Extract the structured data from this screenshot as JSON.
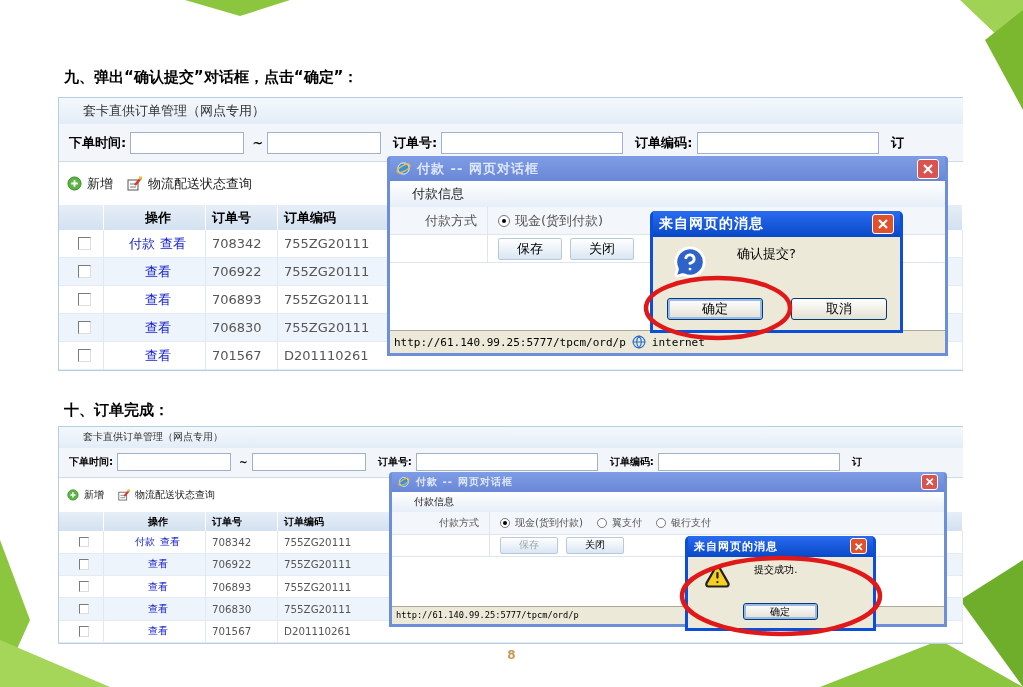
{
  "sections": [
    {
      "heading": "九、弹出“确认提交”对话框，点击“确定”：",
      "highlight": true,
      "app": {
        "title": "套卡直供订单管理（网点专用）",
        "filters": [
          {
            "label": "下单时间:"
          },
          {
            "label": "~"
          },
          {
            "label": "订单号:"
          },
          {
            "label": "订单编码:"
          },
          {
            "label": "订"
          }
        ],
        "toolbar": [
          {
            "kind": "add",
            "label": "新增"
          },
          {
            "kind": "query",
            "label": "物流配送状态查询"
          }
        ],
        "columns": [
          "操作",
          "订单号",
          "订单编码"
        ],
        "rows": [
          {
            "checked": false,
            "actions": [
              "付款",
              "查看"
            ],
            "order_no": "708342",
            "order_code": "755ZG20111"
          },
          {
            "checked": false,
            "actions": [
              "查看"
            ],
            "order_no": "706922",
            "order_code": "755ZG20111"
          },
          {
            "checked": false,
            "actions": [
              "查看"
            ],
            "order_no": "706893",
            "order_code": "755ZG20111"
          },
          {
            "checked": false,
            "actions": [
              "查看"
            ],
            "order_no": "706830",
            "order_code": "755ZG20111"
          },
          {
            "checked": false,
            "actions": [
              "查看"
            ],
            "order_no": "701567",
            "order_code": "D201110261"
          }
        ]
      },
      "dialog": {
        "title": "付款 -- 网页对话框",
        "section": "付款信息",
        "payment_label": "付款方式",
        "options": [
          {
            "label": "现金(货到付款)",
            "selected": true
          }
        ],
        "buttons": [
          {
            "label": "保存",
            "disabled": false
          },
          {
            "label": "关闭",
            "disabled": false
          }
        ],
        "status_url": "http://61.140.99.25:5777/tpcm/ord/p",
        "status_zone": "internet"
      },
      "message": {
        "title": "来自网页的消息",
        "kind": "question",
        "text": "确认提交?",
        "buttons": [
          {
            "label": "确定",
            "focused": true
          },
          {
            "label": "取消",
            "focused": false
          }
        ]
      }
    },
    {
      "heading": "十、订单完成：",
      "highlight": true,
      "app": {
        "title": "套卡直供订单管理（网点专用）",
        "filters": [
          {
            "label": "下单时间:"
          },
          {
            "label": "~"
          },
          {
            "label": "订单号:"
          },
          {
            "label": "订单编码:"
          },
          {
            "label": "订"
          }
        ],
        "toolbar": [
          {
            "kind": "add",
            "label": "新增"
          },
          {
            "kind": "query",
            "label": "物流配送状态查询"
          }
        ],
        "columns": [
          "操作",
          "订单号",
          "订单编码"
        ],
        "rows": [
          {
            "checked": false,
            "actions": [
              "付款",
              "查看"
            ],
            "order_no": "708342",
            "order_code": "755ZG20111"
          },
          {
            "checked": false,
            "actions": [
              "查看"
            ],
            "order_no": "706922",
            "order_code": "755ZG20111"
          },
          {
            "checked": false,
            "actions": [
              "查看"
            ],
            "order_no": "706893",
            "order_code": "755ZG20111"
          },
          {
            "checked": false,
            "actions": [
              "查看"
            ],
            "order_no": "706830",
            "order_code": "755ZG20111"
          },
          {
            "checked": false,
            "actions": [
              "查看"
            ],
            "order_no": "701567",
            "order_code": "D201110261"
          }
        ]
      },
      "dialog": {
        "title": "付款 -- 网页对话框",
        "section": "付款信息",
        "payment_label": "付款方式",
        "options": [
          {
            "label": "现金(货到付款)",
            "selected": true
          },
          {
            "label": "翼支付",
            "selected": false
          },
          {
            "label": "银行支付",
            "selected": false
          }
        ],
        "buttons": [
          {
            "label": "保存",
            "disabled": true
          },
          {
            "label": "关闭",
            "disabled": false
          }
        ],
        "status_url": "http://61.140.99.25:5777/tpcm/ord/p"
      },
      "message": {
        "title": "来自网页的消息",
        "kind": "warning",
        "text": "提交成功.",
        "buttons": [
          {
            "label": "确定",
            "focused": true
          }
        ]
      }
    }
  ],
  "page_number": "8"
}
